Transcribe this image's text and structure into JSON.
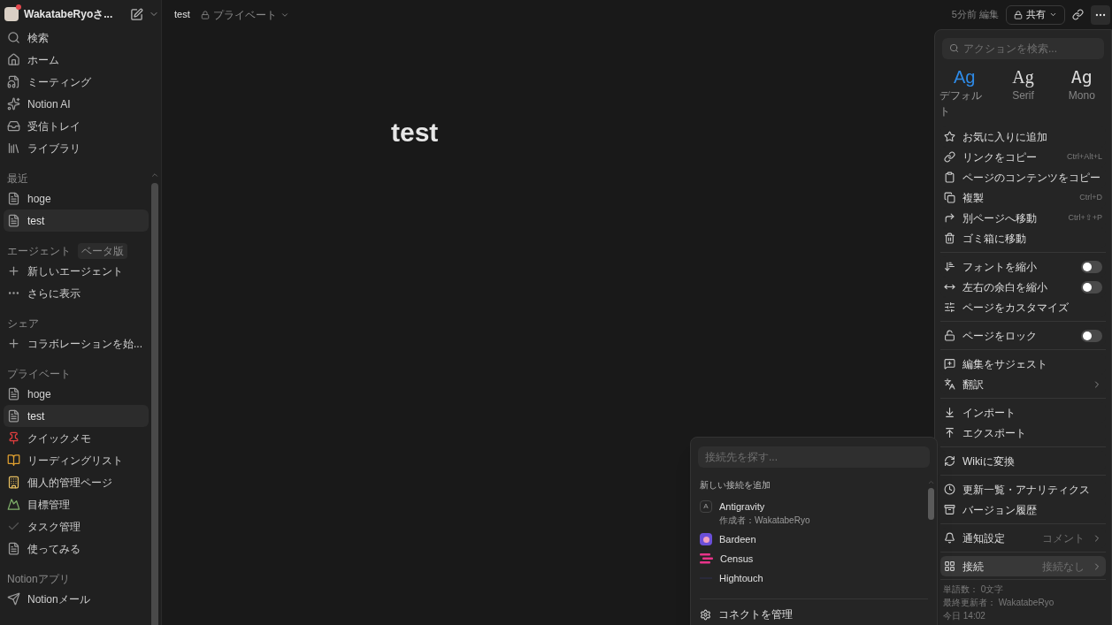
{
  "sidebar": {
    "workspace": "WakatabeRyoさ...",
    "nav": [
      {
        "label": "検索"
      },
      {
        "label": "ホーム"
      },
      {
        "label": "ミーティング"
      },
      {
        "label": "Notion AI"
      },
      {
        "label": "受信トレイ"
      },
      {
        "label": "ライブラリ"
      }
    ],
    "recent": {
      "title": "最近",
      "items": [
        {
          "label": "hoge",
          "selected": false
        },
        {
          "label": "test",
          "selected": true
        }
      ]
    },
    "agents": {
      "title": "エージェント",
      "badge": "ベータ版",
      "items": [
        {
          "label": "新しいエージェント"
        },
        {
          "label": "さらに表示"
        }
      ]
    },
    "share": {
      "title": "シェア",
      "items": [
        {
          "label": "コラボレーションを始..."
        }
      ]
    },
    "private": {
      "title": "プライベート",
      "items": [
        {
          "label": "hoge",
          "selected": false
        },
        {
          "label": "test",
          "selected": true
        },
        {
          "label": "クイックメモ",
          "selected": false
        },
        {
          "label": "リーディングリスト",
          "selected": false
        },
        {
          "label": "個人的管理ページ",
          "selected": false
        },
        {
          "label": "目標管理",
          "selected": false
        },
        {
          "label": "タスク管理",
          "selected": false
        },
        {
          "label": "使ってみる",
          "selected": false
        }
      ]
    },
    "apps": {
      "title": "Notionアプリ",
      "items": [
        {
          "label": "Notionメール"
        }
      ]
    }
  },
  "topbar": {
    "breadcrumb": "test",
    "visibility": "プライベート",
    "edited": "5分前 編集",
    "share": "共有"
  },
  "page": {
    "title": "test"
  },
  "actions_menu": {
    "search": {
      "placeholder": "アクションを検索..."
    },
    "fonts": [
      {
        "sample": "Ag",
        "label": "デフォルト",
        "selected": true
      },
      {
        "sample": "Ag",
        "label": "Serif",
        "selected": false
      },
      {
        "sample": "Ag",
        "label": "Mono",
        "selected": false
      }
    ],
    "groups": [
      [
        {
          "kind": "item",
          "label": "お気に入りに追加"
        },
        {
          "kind": "item",
          "label": "リンクをコピー",
          "shortcut": "Ctrl+Alt+L"
        },
        {
          "kind": "item",
          "label": "ページのコンテンツをコピー"
        },
        {
          "kind": "item",
          "label": "複製",
          "shortcut": "Ctrl+D"
        },
        {
          "kind": "item",
          "label": "別ページへ移動",
          "shortcut": "Ctrl+⇧+P"
        },
        {
          "kind": "item",
          "label": "ゴミ箱に移動"
        }
      ],
      [
        {
          "kind": "toggle",
          "label": "フォントを縮小",
          "on": false
        },
        {
          "kind": "toggle",
          "label": "左右の余白を縮小",
          "on": false
        },
        {
          "kind": "item",
          "label": "ページをカスタマイズ"
        }
      ],
      [
        {
          "kind": "toggle",
          "label": "ページをロック",
          "on": false
        }
      ],
      [
        {
          "kind": "item",
          "label": "編集をサジェスト"
        },
        {
          "kind": "submenu",
          "label": "翻訳"
        }
      ],
      [
        {
          "kind": "item",
          "label": "インポート"
        },
        {
          "kind": "item",
          "label": "エクスポート"
        }
      ],
      [
        {
          "kind": "item",
          "label": "Wikiに変換"
        }
      ],
      [
        {
          "kind": "item",
          "label": "更新一覧・アナリティクス"
        },
        {
          "kind": "item",
          "label": "バージョン履歴"
        }
      ],
      [
        {
          "kind": "submenu",
          "label": "通知設定",
          "value": "コメント"
        }
      ],
      [
        {
          "kind": "submenu",
          "label": "接続",
          "value": "接続なし",
          "selected": true
        }
      ]
    ],
    "footer": [
      "単語数： 0文字",
      "最終更新者： WakatabeRyo",
      "今日 14:02"
    ]
  },
  "connections_popup": {
    "search": {
      "placeholder": "接続先を探す..."
    },
    "heading": "新しい接続を追加",
    "items": [
      {
        "name": "Antigravity",
        "letter": "A",
        "author": "作成者：WakatabeRyo"
      },
      {
        "name": "Bardeen"
      },
      {
        "name": "Census"
      },
      {
        "name": "Hightouch"
      }
    ],
    "manage": "コネクトを管理"
  }
}
